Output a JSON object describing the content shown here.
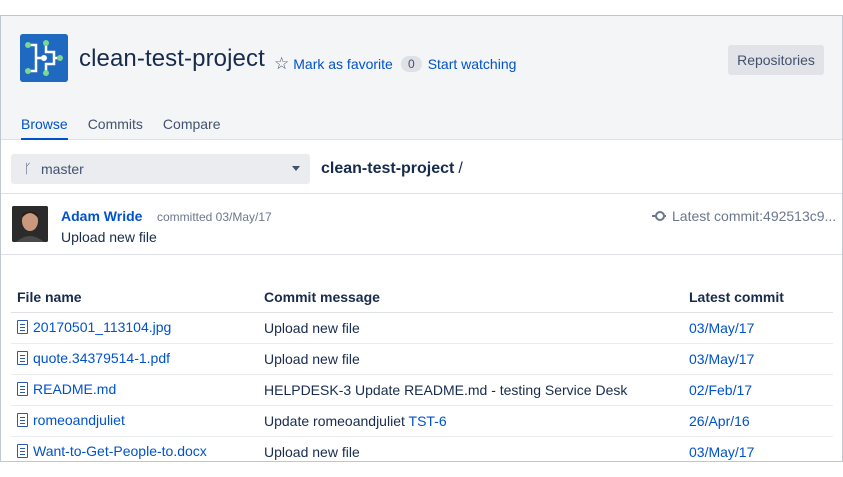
{
  "header": {
    "project_title": "clean-test-project",
    "favorite_label": "Mark as favorite",
    "watch_count": "0",
    "watch_label": "Start watching",
    "repositories_button": "Repositories",
    "tabs": [
      {
        "label": "Browse",
        "active": true
      },
      {
        "label": "Commits",
        "active": false
      },
      {
        "label": "Compare",
        "active": false
      }
    ]
  },
  "branch": {
    "name": "master",
    "icon": "branch-icon"
  },
  "breadcrumb": {
    "repo": "clean-test-project",
    "separator": "/"
  },
  "last_commit": {
    "author": "Adam Wride",
    "committed_text": "committed 03/May/17",
    "message": "Upload new file",
    "latest_commit_text": "Latest commit:492513c9..."
  },
  "table": {
    "headers": [
      "File name",
      "Commit message",
      "Latest commit"
    ],
    "rows": [
      {
        "file": "20170501_113104.jpg",
        "message": "Upload new file",
        "issue": "",
        "date": "03/May/17"
      },
      {
        "file": "quote.34379514-1.pdf",
        "message": "Upload new file",
        "issue": "",
        "date": "03/May/17"
      },
      {
        "file": "README.md",
        "message": "HELPDESK-3 Update README.md - testing Service Desk",
        "issue": "",
        "date": "02/Feb/17"
      },
      {
        "file": "romeoandjuliet",
        "message": "Update romeoandjuliet",
        "issue": "TST-6",
        "date": "26/Apr/16"
      },
      {
        "file": "Want-to-Get-People-to.docx",
        "message": "Upload new file",
        "issue": "",
        "date": "03/May/17"
      }
    ]
  },
  "colors": {
    "link": "#0052cc",
    "header_bg": "#f4f5f7",
    "logo_bg": "#1f69c1"
  }
}
